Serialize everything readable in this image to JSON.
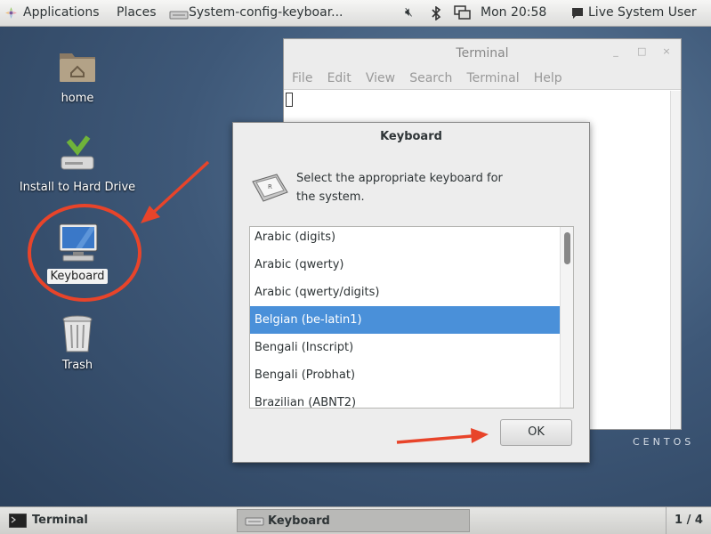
{
  "top_panel": {
    "applications": "Applications",
    "places": "Places",
    "active_window": "System-config-keyboar...",
    "clock": "Mon 20:58",
    "user": "Live System User"
  },
  "desktop": {
    "icons": [
      {
        "label": "home"
      },
      {
        "label": "Install to Hard Drive"
      },
      {
        "label": "Keyboard"
      },
      {
        "label": "Trash"
      }
    ],
    "watermark": "CENTOS"
  },
  "terminal": {
    "title": "Terminal",
    "menu": [
      "File",
      "Edit",
      "View",
      "Search",
      "Terminal",
      "Help"
    ]
  },
  "dialog": {
    "title": "Keyboard",
    "prompt_line1": "Select the appropriate keyboard for",
    "prompt_line2": "the system.",
    "items": [
      "Arabic (digits)",
      "Arabic (qwerty)",
      "Arabic (qwerty/digits)",
      "Belgian (be-latin1)",
      "Bengali (Inscript)",
      "Bengali (Probhat)",
      "Brazilian (ABNT2)"
    ],
    "selected_item": "Belgian (be-latin1)",
    "ok_label": "OK"
  },
  "bottom_panel": {
    "tasks": [
      "Terminal",
      "Keyboard"
    ],
    "workspace": "1 / 4"
  },
  "colors": {
    "selection": "#4a90d9",
    "annotation": "#e8442a"
  }
}
